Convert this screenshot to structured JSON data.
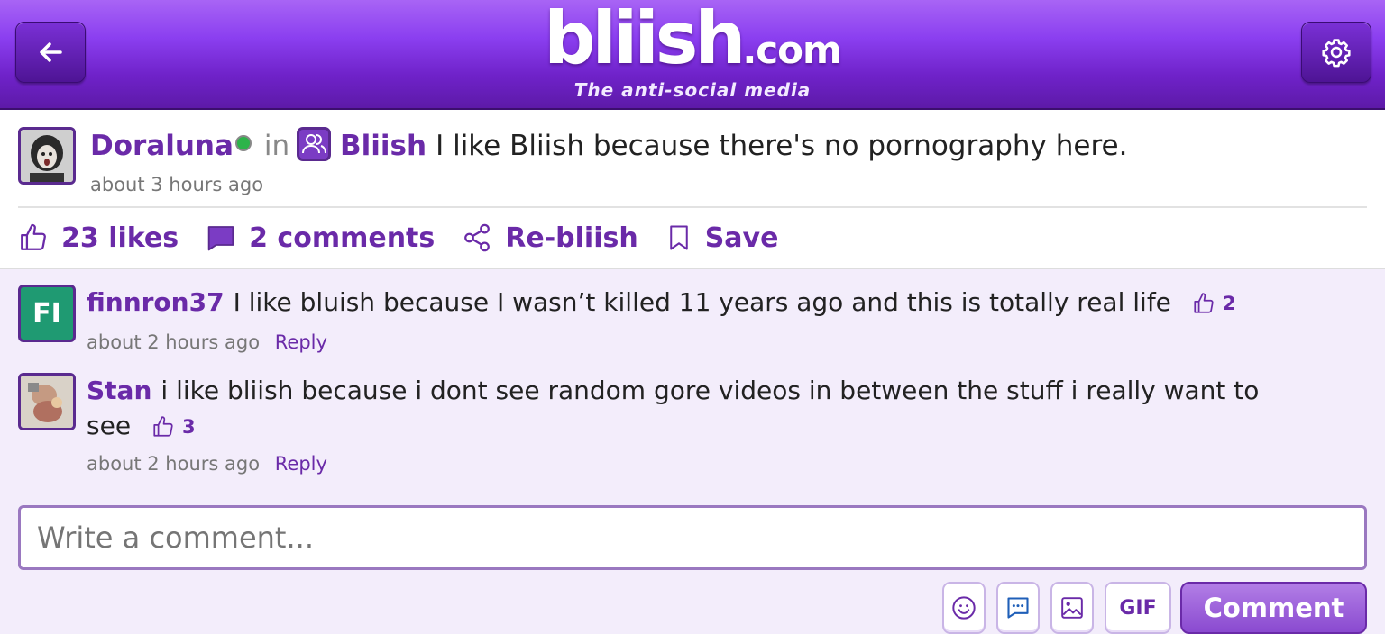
{
  "header": {
    "logo_main": "bliish",
    "logo_domain": ".com",
    "tagline": "The anti-social media",
    "back_icon": "arrow-left-icon",
    "settings_icon": "gear-icon"
  },
  "post": {
    "author": "Doraluna",
    "in_word": "in",
    "group": "Bliish",
    "text": "I like Bliish because there's no pornography here.",
    "time": "about 3 hours ago",
    "likes": "23 likes",
    "comments": "2 comments",
    "rebliish": "Re-bliish",
    "save": "Save"
  },
  "comments": [
    {
      "initials": "FI",
      "author": "finnron37",
      "text": "I like bluish because I wasn’t killed 11 years ago and this is totally real life",
      "likes": "2",
      "time": "about 2 hours ago",
      "reply": "Reply"
    },
    {
      "author": "Stan",
      "text": "i like bliish because i dont see random gore videos in between the stuff i really want to see",
      "likes": "3",
      "time": "about 2 hours ago",
      "reply": "Reply"
    }
  ],
  "composer": {
    "placeholder": "Write a comment...",
    "gif_label": "GIF",
    "submit_label": "Comment"
  },
  "colors": {
    "brand_purple": "#6a2aa8",
    "header_top": "#a864f5",
    "online": "#2db34a"
  }
}
